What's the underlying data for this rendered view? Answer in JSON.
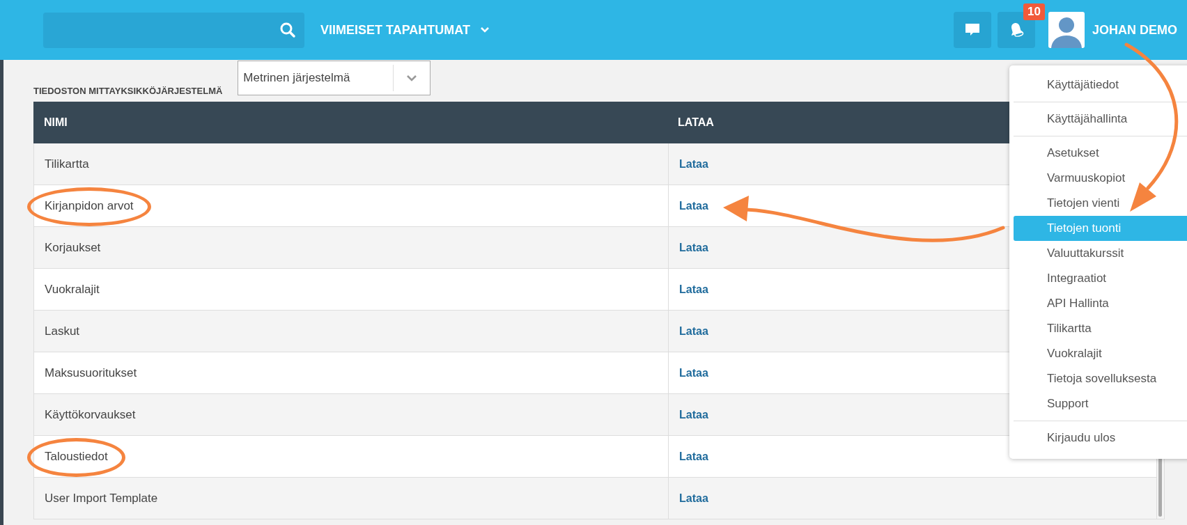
{
  "header": {
    "recent_events": "VIIMEISET TAPAHTUMAT",
    "notification_count": "10",
    "user_name": "JOHAN DEMO"
  },
  "unit_system": {
    "label": "TIEDOSTON MITTAYKSIKKÖJÄRJESTELMÄ",
    "value": "Metrinen järjestelmä"
  },
  "table": {
    "columns": [
      "NIMI",
      "LATAA"
    ],
    "rows": [
      {
        "name": "Tilikartta",
        "link": "Lataa",
        "circled": false,
        "arrow_to_link": false
      },
      {
        "name": "Kirjanpidon arvot",
        "link": "Lataa",
        "circled": true,
        "arrow_to_link": true
      },
      {
        "name": "Korjaukset",
        "link": "Lataa",
        "circled": false,
        "arrow_to_link": false
      },
      {
        "name": "Vuokralajit",
        "link": "Lataa",
        "circled": false,
        "arrow_to_link": false
      },
      {
        "name": "Laskut",
        "link": "Lataa",
        "circled": false,
        "arrow_to_link": false
      },
      {
        "name": "Maksusuoritukset",
        "link": "Lataa",
        "circled": false,
        "arrow_to_link": false
      },
      {
        "name": "Käyttökorvaukset",
        "link": "Lataa",
        "circled": false,
        "arrow_to_link": false
      },
      {
        "name": "Taloustiedot",
        "link": "Lataa",
        "circled": true,
        "arrow_to_link": false
      },
      {
        "name": "User Import Template",
        "link": "Lataa",
        "circled": false,
        "arrow_to_link": false
      }
    ]
  },
  "user_menu": {
    "arrow_from_user": true,
    "groups": [
      [
        {
          "label": "Käyttäjätiedot",
          "selected": false
        }
      ],
      [
        {
          "label": "Käyttäjähallinta",
          "selected": false
        }
      ],
      [
        {
          "label": "Asetukset",
          "selected": false
        },
        {
          "label": "Varmuuskopiot",
          "selected": false
        },
        {
          "label": "Tietojen vienti",
          "selected": false
        },
        {
          "label": "Tietojen tuonti",
          "selected": true
        },
        {
          "label": "Valuuttakurssit",
          "selected": false
        },
        {
          "label": "Integraatiot",
          "selected": false
        },
        {
          "label": "API Hallinta",
          "selected": false
        },
        {
          "label": "Tilikartta",
          "selected": false
        },
        {
          "label": "Vuokralajit",
          "selected": false
        },
        {
          "label": "Tietoja sovelluksesta",
          "selected": false
        },
        {
          "label": "Support",
          "selected": false
        }
      ],
      [
        {
          "label": "Kirjaudu ulos",
          "selected": false
        }
      ]
    ]
  }
}
